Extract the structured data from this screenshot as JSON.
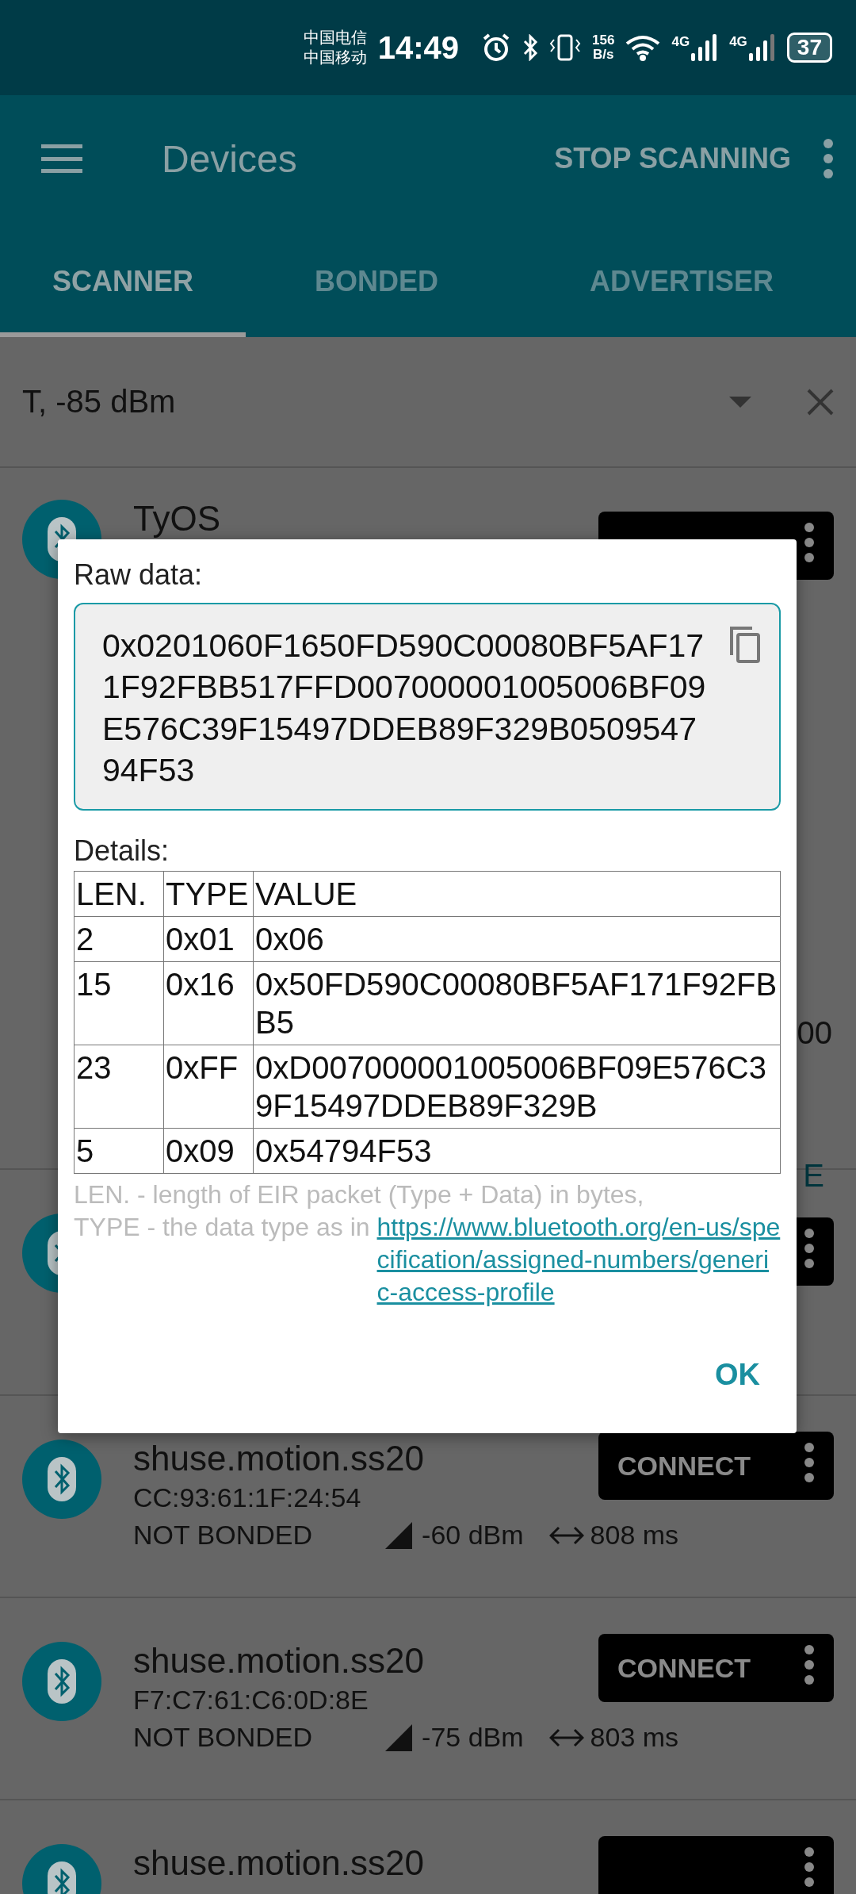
{
  "status_bar": {
    "carriers": [
      "中国电信",
      "中国移动"
    ],
    "time": "14:49",
    "speed": [
      "156",
      "B/s"
    ],
    "network": [
      "4G",
      "4G"
    ],
    "battery": "37"
  },
  "app_bar": {
    "title": "Devices",
    "action": "STOP SCANNING"
  },
  "tabs": [
    {
      "label": "SCANNER",
      "selected": true
    },
    {
      "label": "BONDED",
      "selected": false
    },
    {
      "label": "ADVERTISER",
      "selected": false
    }
  ],
  "filter": {
    "value": "T, -85 dBm"
  },
  "devices": [
    {
      "kind": "expanded",
      "name": "TyOS",
      "fragments": [
        {
          "text": "00",
          "kind": "text"
        },
        {
          "text": "E",
          "kind": "action"
        }
      ]
    },
    {
      "kind": "compact"
    },
    {
      "kind": "compact",
      "name": "shuse.motion.ss20",
      "address": "CC:93:61:1F:24:54",
      "bond": "NOT BONDED",
      "rssi": "-60 dBm",
      "interval": "808 ms",
      "button": "CONNECT"
    },
    {
      "kind": "compact",
      "name": "shuse.motion.ss20",
      "address": "F7:C7:61:C6:0D:8E",
      "bond": "NOT BONDED",
      "rssi": "-75 dBm",
      "interval": "803 ms",
      "button": "CONNECT"
    },
    {
      "kind": "compact",
      "name": "shuse.motion.ss20"
    }
  ],
  "dialog": {
    "raw_label": "Raw data:",
    "raw_value": "0x0201060F1650FD590C00080BF5AF171F92FBB517FFD007000001005006BF09E576C39F15497DDEB89F329B050954794F53",
    "details_label": "Details:",
    "table": {
      "columns": [
        "LEN.",
        "TYPE",
        "VALUE"
      ],
      "rows": [
        [
          "2",
          "0x01",
          "0x06"
        ],
        [
          "15",
          "0x16",
          "0x50FD590C00080BF5AF171F92FBB5"
        ],
        [
          "23",
          "0xFF",
          "0xD007000001005006BF09E576C39F15497DDEB89F329B"
        ],
        [
          "5",
          "0x09",
          "0x54794F53"
        ]
      ]
    },
    "note_1": "LEN. - length of EIR packet (Type + Data) in bytes,",
    "note_2": "TYPE - the data type as in",
    "link": "https://www.bluetooth.org/en-us/specification/assigned-numbers/generic-access-profile",
    "ok": "OK"
  }
}
